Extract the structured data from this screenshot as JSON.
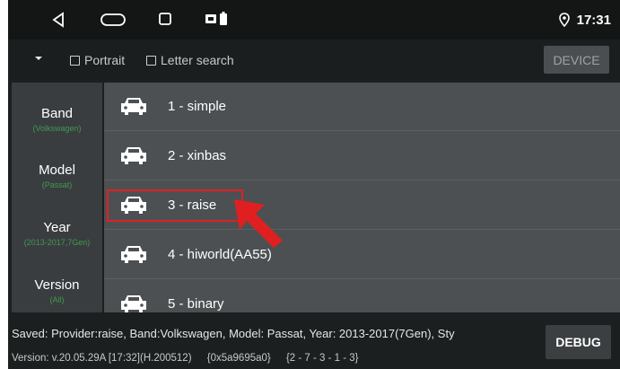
{
  "status_bar": {
    "time": "17:31",
    "nav_icons": [
      "back-icon",
      "home-icon",
      "recents-icon",
      "screenshot-icon",
      "battery-icon"
    ],
    "location_icon": "location-pin-icon"
  },
  "toolbar": {
    "portrait_label": "Portrait",
    "letter_search_label": "Letter search",
    "device_label": "DEVICE"
  },
  "categories": [
    {
      "title": "Band",
      "sub": "(Volkswagen)"
    },
    {
      "title": "Model",
      "sub": "(Passat)"
    },
    {
      "title": "Year",
      "sub": "(2013-2017,7Gen)"
    },
    {
      "title": "Version",
      "sub": "(All)"
    }
  ],
  "list": [
    {
      "label": "1 - simple"
    },
    {
      "label": "2 - xinbas"
    },
    {
      "label": "3 - raise"
    },
    {
      "label": "4 - hiworld(AA55)"
    },
    {
      "label": "5 - binary"
    }
  ],
  "selected_index": 2,
  "footer": {
    "saved": "Saved: Provider:raise, Band:Volkswagen, Model: Passat, Year: 2013-2017(7Gen), Sty",
    "version": "Version: v.20.05.29A [17:32](H.200512)",
    "hex": "{0x5a9695a0}",
    "path": "{2 - 7 - 3 - 1 - 3}",
    "debug_label": "DEBUG"
  },
  "colors": {
    "accent_green": "#3f9a50",
    "highlight_red": "#e02020",
    "panel_dark": "#3a3d3f",
    "list_bg": "#4c5053"
  }
}
